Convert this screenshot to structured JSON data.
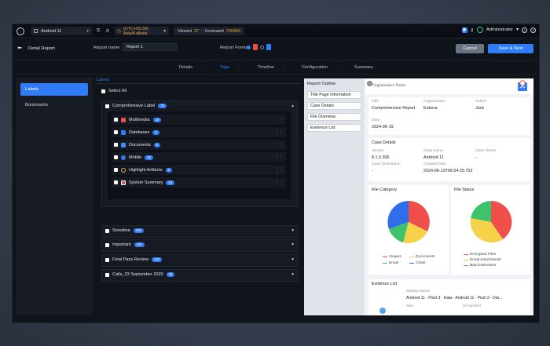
{
  "topbar": {
    "device": "Android 11",
    "timezone": "(UTC+05:30) Asia/Kolkata",
    "viewed_label": "Viewed",
    "viewed_count": "37",
    "unviewed_label": "Unviewed",
    "unviewed_count": "769493",
    "user": "Administrator"
  },
  "subheader": {
    "title": "Detail Report",
    "report_name_label": "Report name",
    "report_name_value": "Report 1",
    "report_format_label": "Report Format",
    "cancel_label": "Cancel",
    "save_label": "Save & Next"
  },
  "steps": [
    "Details",
    "Tags",
    "Timeline",
    "Configuration",
    "Summary"
  ],
  "active_step": "Tags",
  "leftnav": [
    "Labels",
    "Bookmarks"
  ],
  "labels_panel": {
    "title": "Labels",
    "select_all": "Select All",
    "group": {
      "name": "Comprehensive Label",
      "count": "76"
    },
    "subitems": [
      {
        "name": "Multimedia",
        "count": "15",
        "color": "#e8504b"
      },
      {
        "name": "Databases",
        "count": "3",
        "color": "#2f7cf6"
      },
      {
        "name": "Documents",
        "count": "9",
        "color": "#3a8ef0"
      },
      {
        "name": "Mobile",
        "count": "16",
        "color": "#2f7cf6"
      },
      {
        "name": "Highlight Artifacts",
        "count": "8",
        "color": "#f1a43a"
      },
      {
        "name": "System Summary",
        "count": "23",
        "color": "#9aa3b1"
      }
    ],
    "collapsed": [
      {
        "name": "Sensitive",
        "count": "100"
      },
      {
        "name": "Important",
        "count": "100"
      },
      {
        "name": "Final Pass Review",
        "count": "100"
      },
      {
        "name": "Calls_23 September 2020",
        "count": "15"
      }
    ]
  },
  "preview": {
    "outline_title": "Report Outline",
    "outline_items": [
      "Title Page Information",
      "Case Details",
      "File Overview",
      "Evidence List"
    ],
    "org_name": "Organization Name",
    "title_block": {
      "title_label": "Title",
      "title_value": "Comprehensive Report",
      "org_label": "Organization",
      "org_value": "Enterra",
      "author_label": "Author",
      "author_value": "Jack",
      "date_label": "Date",
      "date_value": "2024-06-19"
    },
    "case_details": {
      "heading": "Case Details",
      "version_label": "Version",
      "version_value": "8.1.0.306",
      "case_name_label": "Case name",
      "case_name_value": "Android 11",
      "case_owner_label": "Case Owner",
      "case_owner_value": "-",
      "case_desc_label": "Case Description",
      "case_desc_value": "-",
      "created_label": "Created Date",
      "created_value": "2024-06-13T06:54:25.753"
    },
    "file_category": {
      "heading": "File Category",
      "legend": [
        {
          "name": "Images",
          "color": "#ef4e4a"
        },
        {
          "name": "Documents",
          "color": "#f6d24a"
        },
        {
          "name": "Email",
          "color": "#3cc36b"
        },
        {
          "name": "Chats",
          "color": "#2f6ee8"
        }
      ]
    },
    "file_status": {
      "heading": "File Status",
      "legend": [
        {
          "name": "Encrypted Files",
          "color": "#ef4e4a"
        },
        {
          "name": "Email Attachments",
          "color": "#f6d24a"
        },
        {
          "name": "Bad Extensions",
          "color": "#3cc36b"
        }
      ]
    },
    "evidence": {
      "heading": "Evidence List",
      "display_name_label": "Display Name",
      "display_name_value": "Android 11 - Pixel 3 - Data - Android 11 - Pixel 3 - Dat...",
      "size_label": "Size",
      "id_label": "ID Number"
    }
  }
}
